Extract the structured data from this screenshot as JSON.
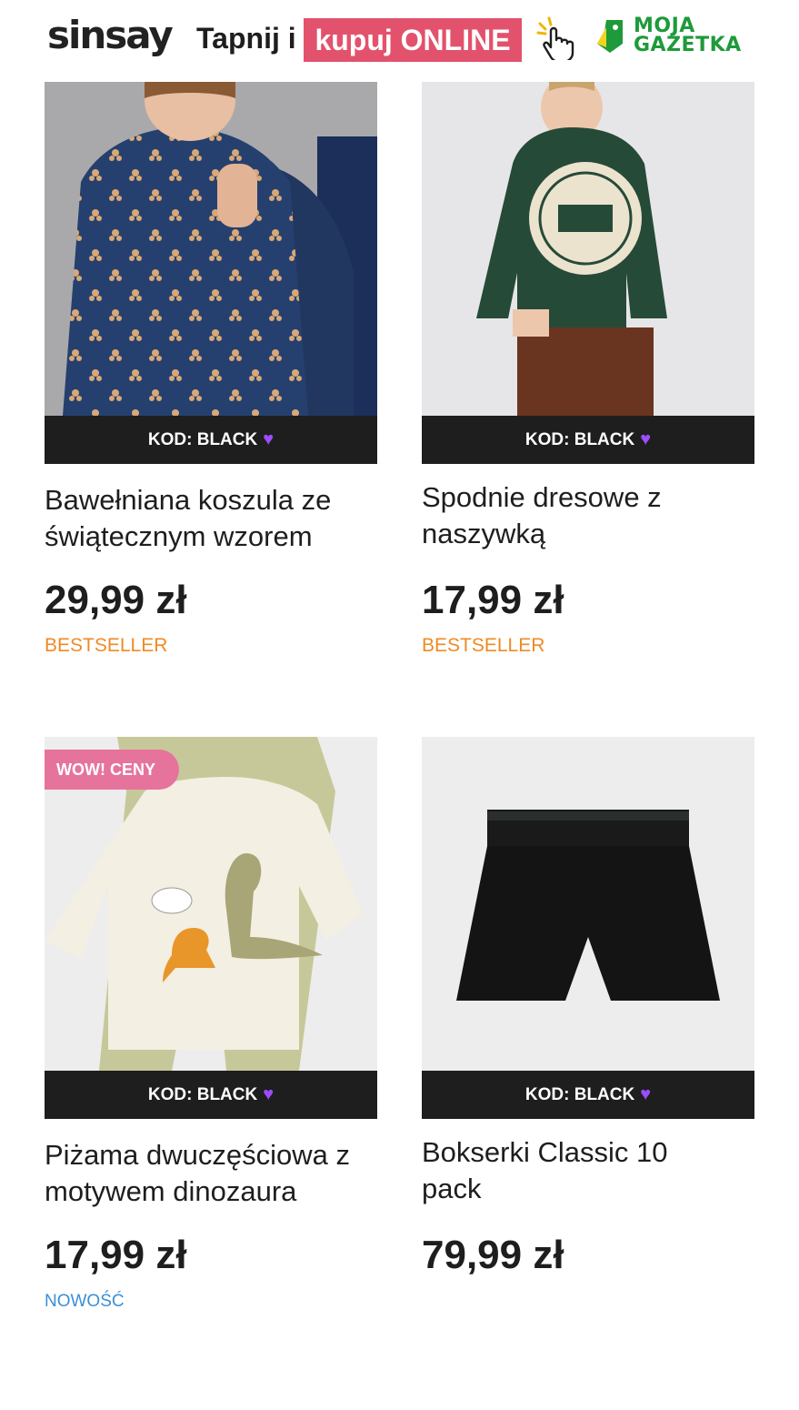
{
  "header": {
    "brand": "sinsay",
    "tap_text": "Tapnij i",
    "online_text": "kupuj ONLINE",
    "gazetka_line1": "MOJA",
    "gazetka_line2": "GAZETKA",
    "hand_icon": "pointing-hand-icon",
    "gazetka_icon": "tag-icon"
  },
  "colors": {
    "accent_pink": "#e3526c",
    "promo_bar": "#1e1e1e",
    "bestseller": "#f08a24",
    "new": "#3a8fd6",
    "wow": "#e6739b",
    "gazetka": "#1e9a3a"
  },
  "products": [
    {
      "promo_code": "KOD: BLACK",
      "name": "Bawełniana koszula ze świątecznym wzorem",
      "price": "29,99 zł",
      "tag": "BESTSELLER"
    },
    {
      "promo_code": "KOD: BLACK",
      "name": "Spodnie dresowe z naszywką",
      "price": "17,99 zł",
      "tag": "BESTSELLER"
    },
    {
      "badge": "WOW! CENY",
      "promo_code": "KOD: BLACK",
      "name": "Piżama dwuczęściowa z motywem dinozaura",
      "price": "17,99 zł",
      "tag": "NOWOŚĆ"
    },
    {
      "promo_code": "KOD: BLACK",
      "name": "Bokserki Classic 10 pack",
      "price": "79,99 zł",
      "tag": ""
    }
  ]
}
